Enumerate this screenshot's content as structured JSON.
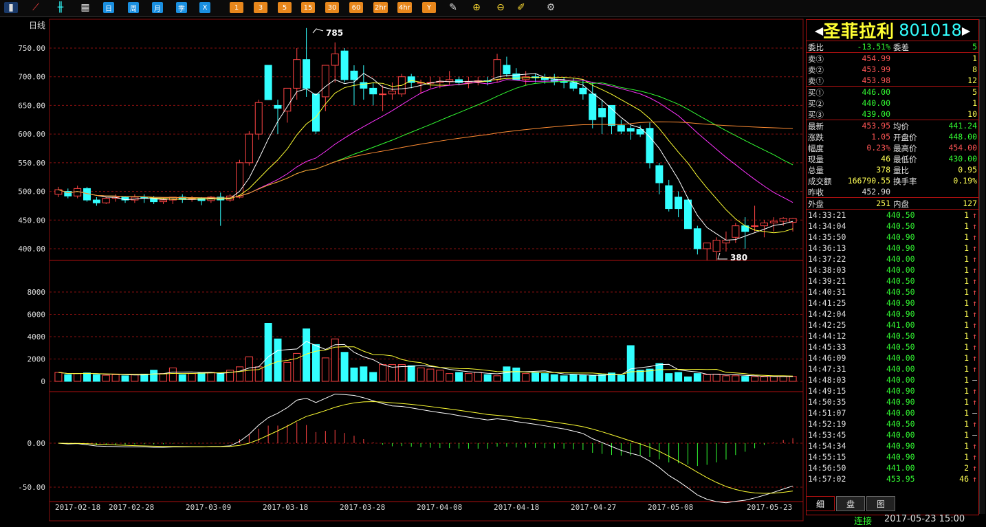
{
  "toolbar": {
    "period_buttons": [
      "日",
      "周",
      "月",
      "季",
      "X"
    ],
    "minute_buttons": [
      "1",
      "3",
      "5",
      "15",
      "30",
      "60",
      "2hr",
      "4hr",
      "Y"
    ]
  },
  "colors": {
    "up": "#ff4444",
    "down": "#33ffff",
    "grid": "#8a1010",
    "ma5": "#ffffff",
    "ma10": "#ffff33",
    "ma20": "#ff33ff",
    "ma30": "#33ff33",
    "ma60": "#ff8c33"
  },
  "chart": {
    "period_label": "日线",
    "price_ticks": [
      "750.00",
      "700.00",
      "650.00",
      "600.00",
      "550.00",
      "500.00",
      "450.00",
      "400.00"
    ],
    "high_marker": "785",
    "low_marker": "380",
    "volume_ticks": [
      "8000",
      "6000",
      "4000",
      "2000",
      "0"
    ],
    "macd_ticks": [
      "0.00",
      "-50.00"
    ],
    "date_labels": [
      "2017-02-18",
      "2017-02-28",
      "2017-03-09",
      "2017-03-18",
      "2017-03-28",
      "2017-04-08",
      "2017-04-18",
      "2017-04-27",
      "2017-05-08",
      "2017-05-23"
    ]
  },
  "chart_data": {
    "type": "candlestick",
    "candles": [
      [
        495,
        508,
        490,
        503
      ],
      [
        500,
        505,
        488,
        492
      ],
      [
        492,
        510,
        488,
        505
      ],
      [
        505,
        508,
        482,
        485
      ],
      [
        485,
        490,
        475,
        480
      ],
      [
        480,
        490,
        478,
        488
      ],
      [
        488,
        495,
        482,
        490
      ],
      [
        490,
        492,
        480,
        485
      ],
      [
        485,
        495,
        480,
        490
      ],
      [
        490,
        495,
        480,
        488
      ],
      [
        488,
        492,
        478,
        482
      ],
      [
        482,
        490,
        478,
        485
      ],
      [
        485,
        490,
        478,
        490
      ],
      [
        490,
        495,
        480,
        486
      ],
      [
        486,
        492,
        482,
        488
      ],
      [
        488,
        490,
        476,
        484
      ],
      [
        484,
        492,
        480,
        490
      ],
      [
        490,
        498,
        440,
        485
      ],
      [
        485,
        495,
        482,
        492
      ],
      [
        490,
        555,
        488,
        550
      ],
      [
        550,
        605,
        545,
        600
      ],
      [
        600,
        660,
        590,
        655
      ],
      [
        720,
        720,
        660,
        660
      ],
      [
        650,
        660,
        600,
        645
      ],
      [
        640,
        680,
        620,
        680
      ],
      [
        680,
        750,
        660,
        730
      ],
      [
        730,
        785,
        665,
        680
      ],
      [
        670,
        670,
        600,
        605
      ],
      [
        665,
        720,
        640,
        720
      ],
      [
        720,
        760,
        690,
        740
      ],
      [
        745,
        750,
        690,
        695
      ],
      [
        710,
        720,
        650,
        695
      ],
      [
        690,
        720,
        660,
        680
      ],
      [
        680,
        690,
        650,
        670
      ],
      [
        670,
        685,
        640,
        670
      ],
      [
        670,
        690,
        660,
        675
      ],
      [
        670,
        705,
        665,
        700
      ],
      [
        700,
        705,
        680,
        690
      ],
      [
        690,
        695,
        670,
        690
      ],
      [
        690,
        700,
        680,
        690
      ],
      [
        690,
        700,
        680,
        692
      ],
      [
        692,
        710,
        685,
        695
      ],
      [
        695,
        700,
        685,
        690
      ],
      [
        690,
        700,
        680,
        692
      ],
      [
        692,
        700,
        685,
        693
      ],
      [
        693,
        700,
        685,
        692
      ],
      [
        695,
        740,
        690,
        730
      ],
      [
        720,
        735,
        700,
        705
      ],
      [
        705,
        715,
        695,
        695
      ],
      [
        695,
        710,
        685,
        700
      ],
      [
        700,
        705,
        690,
        698
      ],
      [
        698,
        705,
        688,
        695
      ],
      [
        695,
        705,
        685,
        692
      ],
      [
        692,
        700,
        680,
        690
      ],
      [
        690,
        698,
        675,
        680
      ],
      [
        680,
        695,
        660,
        670
      ],
      [
        670,
        690,
        610,
        625
      ],
      [
        645,
        660,
        600,
        630
      ],
      [
        650,
        650,
        600,
        615
      ],
      [
        615,
        625,
        600,
        605
      ],
      [
        610,
        615,
        590,
        605
      ],
      [
        608,
        615,
        595,
        600
      ],
      [
        610,
        620,
        540,
        550
      ],
      [
        545,
        550,
        495,
        515
      ],
      [
        510,
        520,
        465,
        470
      ],
      [
        490,
        500,
        455,
        470
      ],
      [
        485,
        490,
        440,
        435
      ],
      [
        435,
        440,
        390,
        400
      ],
      [
        400,
        410,
        380,
        410
      ],
      [
        395,
        420,
        380,
        415
      ],
      [
        410,
        430,
        395,
        415
      ],
      [
        420,
        445,
        410,
        440
      ],
      [
        440,
        455,
        400,
        430
      ],
      [
        440,
        475,
        430,
        440
      ],
      [
        440,
        450,
        420,
        445
      ],
      [
        445,
        455,
        430,
        448
      ],
      [
        448,
        455,
        440,
        453
      ],
      [
        446,
        454,
        430,
        453
      ]
    ],
    "volume": [
      800,
      600,
      700,
      750,
      600,
      550,
      600,
      500,
      600,
      650,
      1000,
      700,
      1200,
      600,
      700,
      750,
      800,
      700,
      1000,
      1300,
      2200,
      1300,
      5200,
      3800,
      1700,
      2500,
      4700,
      3300,
      2100,
      3800,
      2600,
      1200,
      1300,
      800,
      1500,
      1500,
      1500,
      1400,
      1200,
      1100,
      1000,
      700,
      800,
      700,
      800,
      600,
      500,
      1300,
      1200,
      700,
      800,
      700,
      600,
      500,
      600,
      550,
      500,
      600,
      750,
      550,
      3200,
      1000,
      1100,
      1600,
      700,
      800,
      400,
      700,
      600,
      650,
      500,
      500,
      450,
      400,
      400,
      420,
      400,
      450
    ]
  },
  "panel": {
    "name": "圣菲拉利",
    "code": "801018",
    "quote_rows": [
      {
        "l": "委比",
        "v": "-13.51%",
        "v_cls": "green",
        "l2": "委差",
        "v2": "5",
        "v2_cls": "green"
      },
      {
        "l": "卖③",
        "v": "454.99",
        "v_cls": "red",
        "v2": "1",
        "v2_cls": "yellow"
      },
      {
        "l": "卖②",
        "v": "453.99",
        "v_cls": "red",
        "v2": "8",
        "v2_cls": "yellow"
      },
      {
        "l": "卖①",
        "v": "453.98",
        "v_cls": "red",
        "v2": "12",
        "v2_cls": "yellow"
      },
      {
        "l": "买①",
        "v": "446.00",
        "v_cls": "green",
        "v2": "5",
        "v2_cls": "yellow"
      },
      {
        "l": "买②",
        "v": "440.00",
        "v_cls": "green",
        "v2": "1",
        "v2_cls": "yellow"
      },
      {
        "l": "买③",
        "v": "439.00",
        "v_cls": "green",
        "v2": "10",
        "v2_cls": "yellow"
      },
      {
        "l": "最新",
        "v": "453.95",
        "v_cls": "red",
        "l2": "均价",
        "v2": "441.24",
        "v2_cls": "green"
      },
      {
        "l": "涨跌",
        "v": "1.05",
        "v_cls": "red",
        "l2": "开盘价",
        "v2": "448.00",
        "v2_cls": "green"
      },
      {
        "l": "幅度",
        "v": "0.23%",
        "v_cls": "red",
        "l2": "最高价",
        "v2": "454.00",
        "v2_cls": "red"
      },
      {
        "l": "现量",
        "v": "46",
        "v_cls": "yellow",
        "l2": "最低价",
        "v2": "430.00",
        "v2_cls": "green"
      },
      {
        "l": "总量",
        "v": "378",
        "v_cls": "yellow",
        "l2": "量比",
        "v2": "0.95",
        "v2_cls": "yellow"
      },
      {
        "l": "成交额",
        "v": "166790.55",
        "v_cls": "yellow",
        "l2": "换手率",
        "v2": "0.19%",
        "v2_cls": "yellow"
      },
      {
        "l": "昨收",
        "v": "452.90",
        "v_cls": "white",
        "l2": "",
        "v2": "",
        "v2_cls": "white"
      },
      {
        "l": "外盘",
        "v": "251",
        "v_cls": "yellow",
        "l2": "内盘",
        "v2": "127",
        "v2_cls": "yellow"
      }
    ],
    "ticks": [
      [
        "14:33:21",
        "440.50",
        "1",
        "↑"
      ],
      [
        "14:34:04",
        "440.50",
        "1",
        "↑"
      ],
      [
        "14:35:50",
        "440.90",
        "1",
        "↑"
      ],
      [
        "14:36:13",
        "440.90",
        "1",
        "↑"
      ],
      [
        "14:37:22",
        "440.00",
        "1",
        "↑"
      ],
      [
        "14:38:03",
        "440.00",
        "1",
        "↑"
      ],
      [
        "14:39:21",
        "440.50",
        "1",
        "↑"
      ],
      [
        "14:40:31",
        "440.50",
        "1",
        "↑"
      ],
      [
        "14:41:25",
        "440.90",
        "1",
        "↑"
      ],
      [
        "14:42:04",
        "440.90",
        "1",
        "↑"
      ],
      [
        "14:42:25",
        "441.00",
        "1",
        "↑"
      ],
      [
        "14:44:12",
        "440.50",
        "1",
        "↑"
      ],
      [
        "14:45:33",
        "440.50",
        "1",
        "↑"
      ],
      [
        "14:46:09",
        "440.00",
        "1",
        "↑"
      ],
      [
        "14:47:31",
        "440.00",
        "1",
        "↑"
      ],
      [
        "14:48:03",
        "440.00",
        "1",
        "—"
      ],
      [
        "14:49:15",
        "440.90",
        "1",
        "↑"
      ],
      [
        "14:50:35",
        "440.90",
        "1",
        "↑"
      ],
      [
        "14:51:07",
        "440.00",
        "1",
        "—"
      ],
      [
        "14:52:19",
        "440.50",
        "1",
        "↑"
      ],
      [
        "14:53:45",
        "440.00",
        "1",
        "—"
      ],
      [
        "14:54:34",
        "440.90",
        "1",
        "↑"
      ],
      [
        "14:55:15",
        "440.90",
        "1",
        "↑"
      ],
      [
        "14:56:50",
        "441.00",
        "2",
        "↑"
      ],
      [
        "14:57:02",
        "453.95",
        "46",
        "↑"
      ]
    ],
    "tabs": [
      "细",
      "盘",
      "图"
    ]
  },
  "status": {
    "connection": "连接",
    "datetime": "2017-05-23 15:00"
  }
}
